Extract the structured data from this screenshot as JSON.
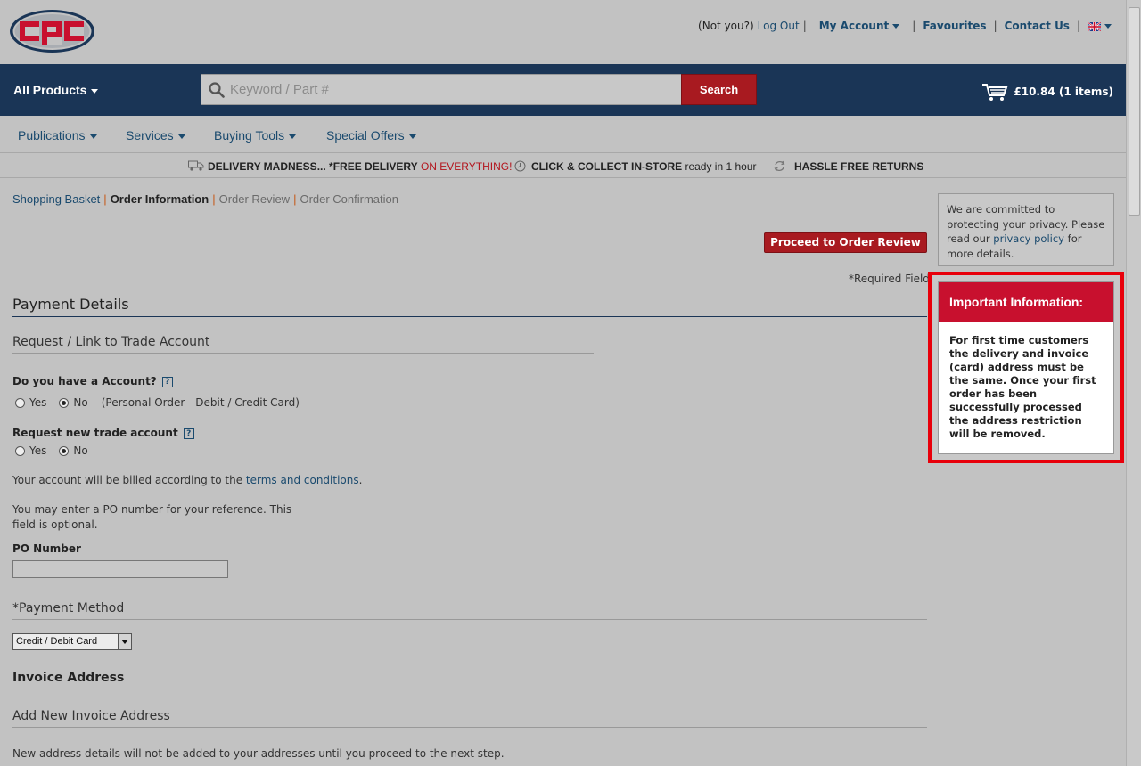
{
  "header": {
    "not_you": "(Not you?)",
    "logout": "Log Out",
    "my_account": "My Account",
    "favourites": "Favourites",
    "contact": "Contact Us",
    "sep": "|"
  },
  "nav": {
    "all_products": "All Products",
    "search_placeholder": "Keyword / Part #",
    "search_button": "Search",
    "cart": "£10.84 (1 items)"
  },
  "subnav": {
    "items": [
      "Publications",
      "Services",
      "Buying Tools",
      "Special Offers"
    ]
  },
  "promo": {
    "delivery_a": "DELIVERY MADNESS... *FREE DELIVERY",
    "delivery_b": "ON EVERYTHING!",
    "collect_a": "CLICK & COLLECT IN-STORE",
    "collect_b": "ready in 1 hour",
    "returns": "HASSLE FREE RETURNS"
  },
  "breadcrumb": {
    "basket": "Shopping Basket",
    "info": "Order Information",
    "review": "Order Review",
    "confirm": "Order Confirmation",
    "sep": "|"
  },
  "actions": {
    "proceed": "Proceed to Order Review",
    "required": "*Required Field"
  },
  "form": {
    "payment_details": "Payment Details",
    "request_link": "Request / Link to Trade Account",
    "have_account": "Do you have a Account?",
    "yes": "Yes",
    "no": "No",
    "no_note": "(Personal Order - Debit / Credit Card)",
    "request_new": "Request new trade account",
    "billed_a": "Your account will be billed according to the",
    "billed_link": "terms and conditions",
    "billed_b": ".",
    "po_note_1": "You may enter a PO number for your reference. This",
    "po_note_2": "field is optional.",
    "po_label": "PO Number",
    "po_value": "",
    "payment_method": "*Payment Method",
    "payment_selected": "Credit / Debit Card",
    "invoice_address": "Invoice Address",
    "add_invoice": "Add New Invoice Address",
    "new_address_note": "New address details will not be added to your addresses until you proceed to the next step."
  },
  "sidebar": {
    "privacy_a": "We are committed to protecting your privacy. Please read our",
    "privacy_link": "privacy policy",
    "privacy_b": "for more details.",
    "important_title": "Important Information:",
    "important_body": "For first time customers the delivery and invoice (card) address must be the same. Once your first order has been successfully processed the address restriction will be removed."
  },
  "colors": {
    "navy": "#1a3556",
    "brand_red": "#a81a20",
    "highlight_red": "#e8000b",
    "link": "#1a4a6e"
  }
}
